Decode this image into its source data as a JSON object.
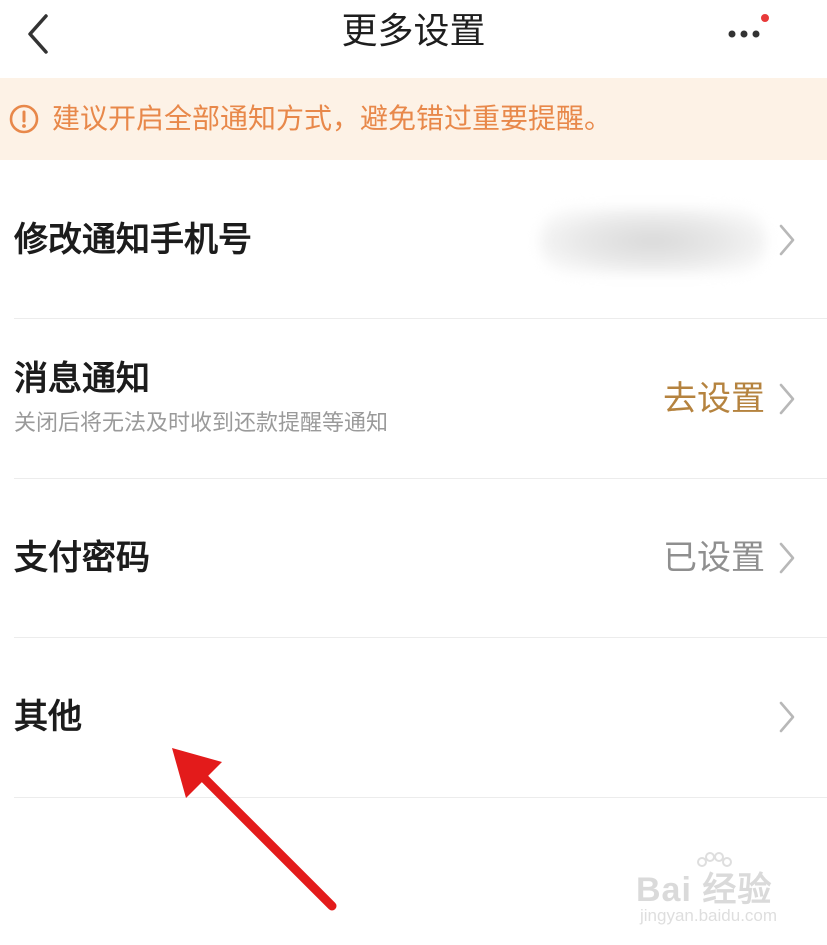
{
  "colors": {
    "accent_orange": "#e8884a",
    "value_gold": "#b5833f",
    "value_gray": "#8f8f8f",
    "notice_bg": "#fdf2e6",
    "badge_red": "#e83a3a",
    "annotation_red": "#e31b1b"
  },
  "header": {
    "title": "更多设置",
    "back_icon": "chevron-left-icon",
    "more_icon": "more-dots-icon",
    "has_badge": true
  },
  "notice": {
    "icon": "alert-circle-icon",
    "text": "建议开启全部通知方式，避免错过重要提醒。"
  },
  "settings": [
    {
      "title": "修改通知手机号",
      "subtitle": "",
      "value": "",
      "value_blurred": true
    },
    {
      "title": "消息通知",
      "subtitle": "关闭后将无法及时收到还款提醒等通知",
      "value": "去设置",
      "value_style": "accent"
    },
    {
      "title": "支付密码",
      "subtitle": "",
      "value": "已设置",
      "value_style": "muted"
    },
    {
      "title": "其他",
      "subtitle": "",
      "value": ""
    }
  ],
  "watermark": {
    "logo": "Bai 经验",
    "url": "jingyan.baidu.com"
  }
}
